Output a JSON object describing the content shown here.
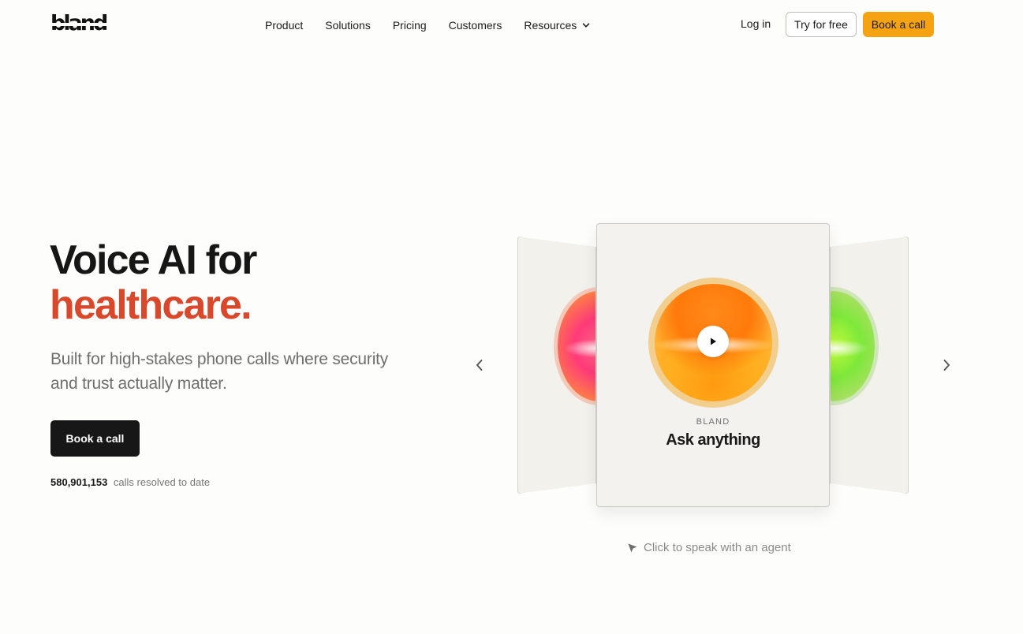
{
  "header": {
    "logo_text": "bland",
    "nav": [
      {
        "label": "Product"
      },
      {
        "label": "Solutions"
      },
      {
        "label": "Pricing"
      },
      {
        "label": "Customers"
      },
      {
        "label": "Resources",
        "icon": "chevron-down-icon"
      }
    ],
    "login_label": "Log in",
    "try_label": "Try for free",
    "book_label": "Book a call"
  },
  "hero": {
    "headline_line1": "Voice AI for",
    "headline_line2": "healthcare.",
    "subhead": "Built for high-stakes phone calls where security and trust actually matter.",
    "cta_label": "Book a call",
    "stat_number": "580,901,153",
    "stat_label": "calls resolved to date"
  },
  "carousel": {
    "card_eyebrow": "BLAND",
    "card_title": "Ask anything",
    "hint": "Click to speak with an agent",
    "icons": [
      "chevron-left-icon",
      "chevron-right-icon",
      "play-icon",
      "cursor-icon"
    ]
  },
  "colors": {
    "accent_orange": "#f6a313",
    "headline_red": "#d9482a",
    "dark": "#171717"
  }
}
